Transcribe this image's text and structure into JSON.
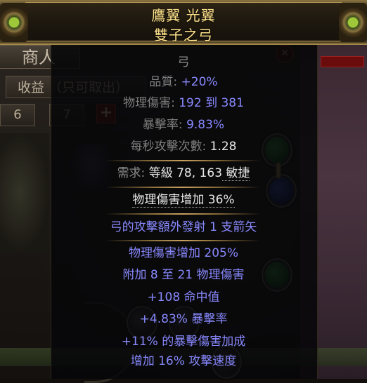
{
  "background": {
    "merchant_tab": "商人",
    "income_tab": "收益 （只可取出）",
    "stash_tabs": [
      "6",
      "7"
    ],
    "add_tab": "+"
  },
  "item": {
    "name": "鷹翼 光翼",
    "base_type": "雙子之弓",
    "item_class": "弓",
    "properties": [
      {
        "label": "品質: ",
        "value": "+20%"
      },
      {
        "label": "物理傷害: ",
        "value": "192 到 381"
      },
      {
        "label": "暴擊率: ",
        "value": "9.83%"
      },
      {
        "label": "每秒攻擊次數: ",
        "value": "1.28"
      }
    ],
    "requirements": {
      "label": "需求: ",
      "level_label": "等級 ",
      "level": "78",
      "dex": "163",
      "dex_label": " 敏捷"
    },
    "enchant": "物理傷害增加 36%",
    "implicit": "弓的攻擊額外發射 1 支箭矢",
    "explicit_mods": [
      "物理傷害增加 205%",
      "附加 8 至 21 物理傷害",
      "+108 命中值",
      "+4.83% 暴擊率",
      "+11% 的暴擊傷害加成",
      "增加 16% 攻擊速度"
    ]
  },
  "colors": {
    "unique_name": "#ffe28a",
    "mod_blue": "#8888ff",
    "label_gray": "#7f7f7f"
  }
}
